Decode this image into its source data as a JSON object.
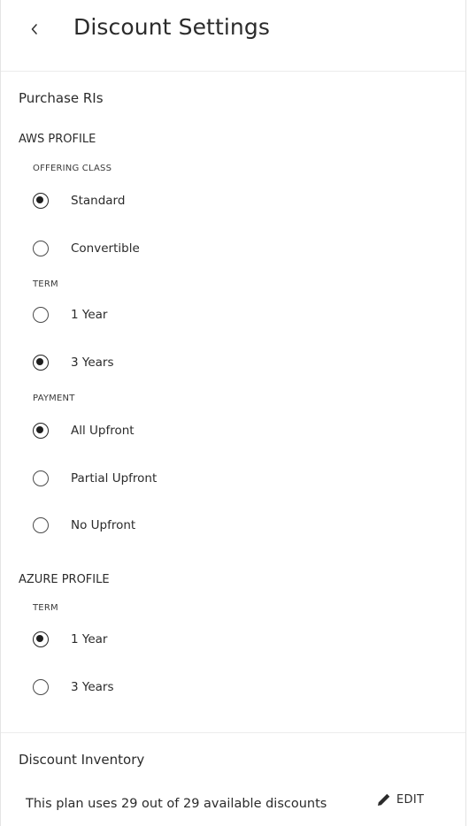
{
  "header": {
    "title": "Discount Settings"
  },
  "purchase": {
    "title": "Purchase RIs",
    "aws": {
      "title": "AWS PROFILE",
      "offering_class": {
        "label": "OFFERING CLASS",
        "options": [
          {
            "label": "Standard",
            "checked": true
          },
          {
            "label": "Convertible",
            "checked": false
          }
        ]
      },
      "term": {
        "label": "TERM",
        "options": [
          {
            "label": "1 Year",
            "checked": false
          },
          {
            "label": "3 Years",
            "checked": true
          }
        ]
      },
      "payment": {
        "label": "PAYMENT",
        "options": [
          {
            "label": "All Upfront",
            "checked": true
          },
          {
            "label": "Partial Upfront",
            "checked": false
          },
          {
            "label": "No Upfront",
            "checked": false
          }
        ]
      }
    },
    "azure": {
      "title": "AZURE PROFILE",
      "term": {
        "label": "TERM",
        "options": [
          {
            "label": "1 Year",
            "checked": true
          },
          {
            "label": "3 Years",
            "checked": false
          }
        ]
      }
    }
  },
  "inventory": {
    "title": "Discount Inventory",
    "summary": "This plan uses 29 out of 29 available discounts",
    "edit_label": "EDIT"
  }
}
